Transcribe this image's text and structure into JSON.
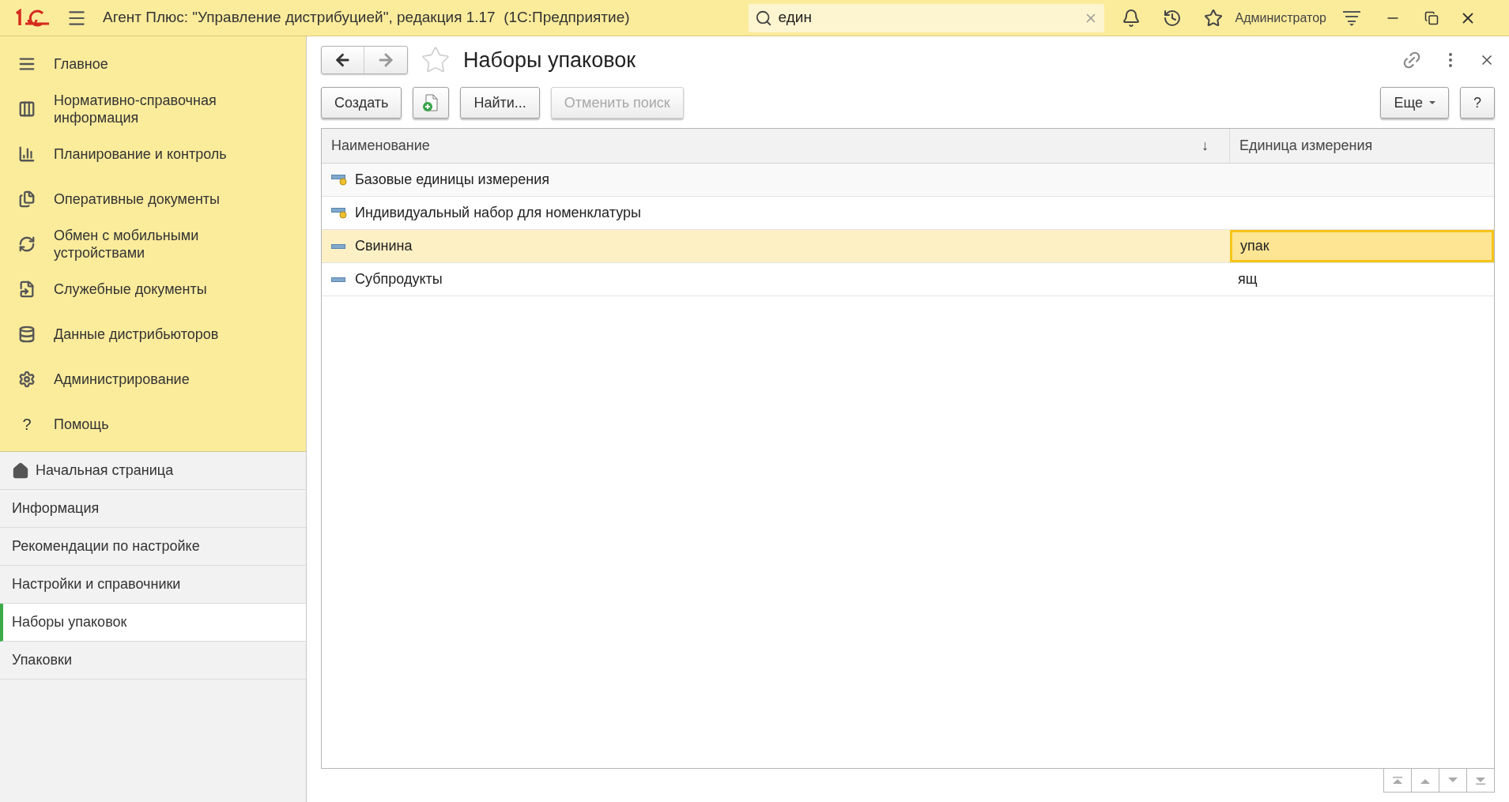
{
  "title_bar": {
    "title": "Агент Плюс: \"Управление дистрибуцией\", редакция 1.17  (1С:Предприятие)",
    "search": {
      "value": "един"
    },
    "user": "Администратор"
  },
  "sections": [
    {
      "label": "Главное"
    },
    {
      "label": "Нормативно-справочная информация"
    },
    {
      "label": "Планирование и контроль"
    },
    {
      "label": "Оперативные документы"
    },
    {
      "label": "Обмен с мобильными устройствами"
    },
    {
      "label": "Служебные документы"
    },
    {
      "label": "Данные дистрибьюторов"
    },
    {
      "label": "Администрирование"
    },
    {
      "label": "Помощь",
      "glyph": "?"
    }
  ],
  "open_windows": [
    {
      "label": "Начальная страница",
      "selected": false
    },
    {
      "label": "Информация",
      "selected": false
    },
    {
      "label": "Рекомендации по настройке",
      "selected": false
    },
    {
      "label": "Настройки и справочники",
      "selected": false
    },
    {
      "label": "Наборы упаковок",
      "selected": true
    },
    {
      "label": "Упаковки",
      "selected": false
    }
  ],
  "form": {
    "title": "Наборы упаковок",
    "buttons": [
      {
        "label": "Создать",
        "disabled": false
      },
      {
        "label": "Найти...",
        "disabled": false
      },
      {
        "label": "Отменить поиск",
        "disabled": true
      }
    ],
    "more": "Еще",
    "help": "?"
  },
  "table": {
    "columns": [
      {
        "label": "Наименование",
        "sort": "↓"
      },
      {
        "label": "Единица измерения"
      }
    ],
    "rows": [
      {
        "name": "Базовые единицы измерения",
        "predefined": true,
        "selected": false
      },
      {
        "name": "Индивидуальный набор для номенклатуры",
        "predefined": true,
        "selected": false
      },
      {
        "name": "Свинина",
        "unit": "упак",
        "predefined": false,
        "selected": true
      },
      {
        "name": "Субпродукты",
        "unit": "ящ",
        "predefined": false,
        "selected": false
      }
    ]
  }
}
